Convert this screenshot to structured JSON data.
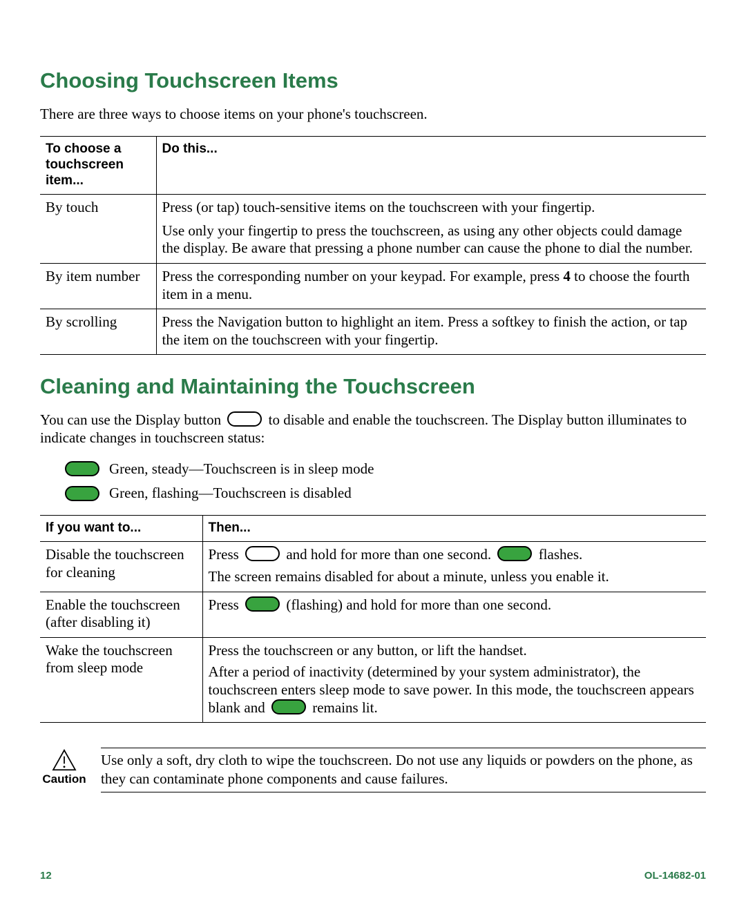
{
  "section1": {
    "heading": "Choosing Touchscreen Items",
    "intro": "There are three ways to choose items on your phone's touchscreen."
  },
  "table1": {
    "header": [
      "To choose a touchscreen item...",
      "Do this..."
    ],
    "rows": [
      {
        "left": "By touch",
        "right_para1": "Press (or tap) touch-sensitive items on the touchscreen with your fingertip.",
        "right_para2": "Use only your fingertip to press the touchscreen, as using any other objects could damage the display. Be aware that pressing a phone number can cause the phone to dial the number."
      },
      {
        "left": "By item number",
        "right_pre": "Press the corresponding number on your keypad. For example, press ",
        "right_bold": "4",
        "right_post": " to choose the fourth item in a menu."
      },
      {
        "left": "By scrolling",
        "right": "Press the Navigation button to highlight an item. Press a softkey to finish the action, or tap the item on the touchscreen with your fingertip."
      }
    ]
  },
  "section2": {
    "heading": "Cleaning and Maintaining the Touchscreen",
    "intro_pre": "You can use the Display button ",
    "intro_post": " to disable and enable the touchscreen. The Display button illuminates to indicate changes in touchscreen status:",
    "bullets": [
      "Green, steady—Touchscreen is in sleep mode",
      "Green, flashing—Touchscreen is disabled"
    ]
  },
  "table2": {
    "header": [
      "If you want to...",
      "Then..."
    ],
    "rows": [
      {
        "left": "Disable the touchscreen for cleaning",
        "r1_a": "Press ",
        "r1_b": " and hold for more than one second. ",
        "r1_c": " flashes.",
        "r2": "The screen remains disabled for about a minute, unless you enable it."
      },
      {
        "left": "Enable the touchscreen (after disabling it)",
        "r_a": "Press ",
        "r_b": " (flashing) and hold for more than one second."
      },
      {
        "left": "Wake the touchscreen from sleep mode",
        "r1": "Press the touchscreen or any button, or lift the handset.",
        "r2_a": "After a period of inactivity (determined by your system administrator), the touchscreen enters sleep mode to save power. In this mode, the touchscreen appears blank and ",
        "r2_b": " remains lit."
      }
    ]
  },
  "caution": {
    "label": "Caution",
    "text": "Use only a soft, dry cloth to wipe the touchscreen. Do not use any liquids or powders on the phone, as they can contaminate phone components and cause failures."
  },
  "footer": {
    "page": "12",
    "docid": "OL-14682-01"
  }
}
